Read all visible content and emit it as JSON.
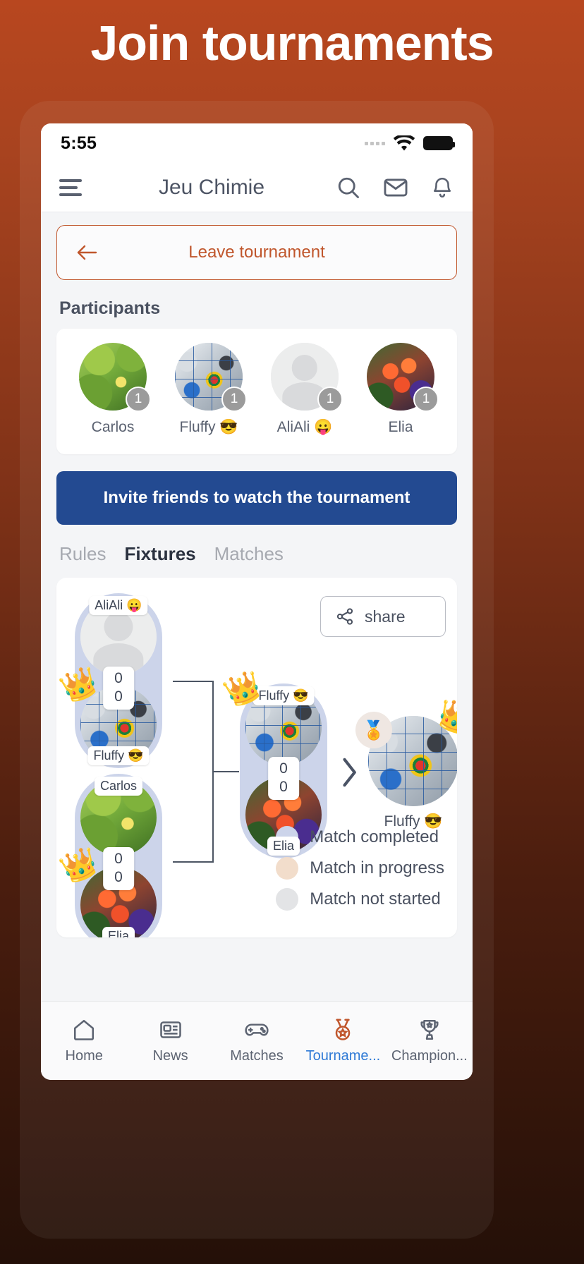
{
  "promo": {
    "headline": "Join tournaments"
  },
  "status_bar": {
    "time": "5:55",
    "wifi_icon": "wifi-icon",
    "battery_icon": "battery-full-icon",
    "signal_icon": "signal-dots-icon"
  },
  "header": {
    "menu_icon": "hamburger-menu-icon",
    "title": "Jeu Chimie",
    "search_icon": "search-icon",
    "mail_icon": "mail-icon",
    "bell_icon": "bell-icon"
  },
  "leave_button": {
    "label": "Leave tournament",
    "icon": "arrow-left-icon",
    "color": "#c0562c"
  },
  "participants_section": {
    "title": "Participants",
    "items": [
      {
        "name": "Carlos",
        "badge": "1",
        "avatar": "leaf-photo"
      },
      {
        "name": "Fluffy 😎",
        "badge": "1",
        "avatar": "collage-photo"
      },
      {
        "name": "AliAli 😛",
        "badge": "1",
        "avatar": "default-person"
      },
      {
        "name": "Elia",
        "badge": "1",
        "avatar": "flower-photo"
      }
    ]
  },
  "invite_button": {
    "label": "Invite friends to watch the tournament",
    "color": "#234a91"
  },
  "tabs": [
    {
      "label": "Rules",
      "active": false
    },
    {
      "label": "Fixtures",
      "active": true
    },
    {
      "label": "Matches",
      "active": false
    }
  ],
  "bracket": {
    "share_button": {
      "label": "share",
      "icon": "share-icon"
    },
    "round1": [
      {
        "state": "completed",
        "top": {
          "name": "AliAli 😛",
          "avatar": "default-person",
          "score": "0",
          "winner": false
        },
        "bottom": {
          "name": "Fluffy 😎",
          "avatar": "collage-photo",
          "score": "0",
          "winner": true
        }
      },
      {
        "state": "completed",
        "top": {
          "name": "Carlos",
          "avatar": "leaf-photo",
          "score": "0",
          "winner": false
        },
        "bottom": {
          "name": "Elia",
          "avatar": "flower-photo",
          "score": "0",
          "winner": true
        }
      }
    ],
    "round2": [
      {
        "state": "completed",
        "top": {
          "name": "Fluffy 😎",
          "avatar": "collage-photo",
          "score": "0",
          "winner": true
        },
        "bottom": {
          "name": "Elia",
          "avatar": "flower-photo",
          "score": "0",
          "winner": false
        }
      }
    ],
    "champion": {
      "name": "Fluffy 😎",
      "avatar": "collage-photo",
      "medal_icon": "medal-icon",
      "chevron_icon": "chevron-right-icon",
      "crown_icon": "crown-icon"
    },
    "legend": [
      {
        "label": "Match completed",
        "color": "#ccd4ea"
      },
      {
        "label": "Match in progress",
        "color": "#f2ddcb"
      },
      {
        "label": "Match not started",
        "color": "#e3e4e6"
      }
    ]
  },
  "bottom_nav": [
    {
      "label": "Home",
      "icon": "home-icon",
      "active": false
    },
    {
      "label": "News",
      "icon": "news-icon",
      "active": false
    },
    {
      "label": "Matches",
      "icon": "gamepad-icon",
      "active": false
    },
    {
      "label": "Tourname...",
      "icon": "medal-icon",
      "active": true
    },
    {
      "label": "Champion...",
      "icon": "trophy-icon",
      "active": false
    }
  ]
}
